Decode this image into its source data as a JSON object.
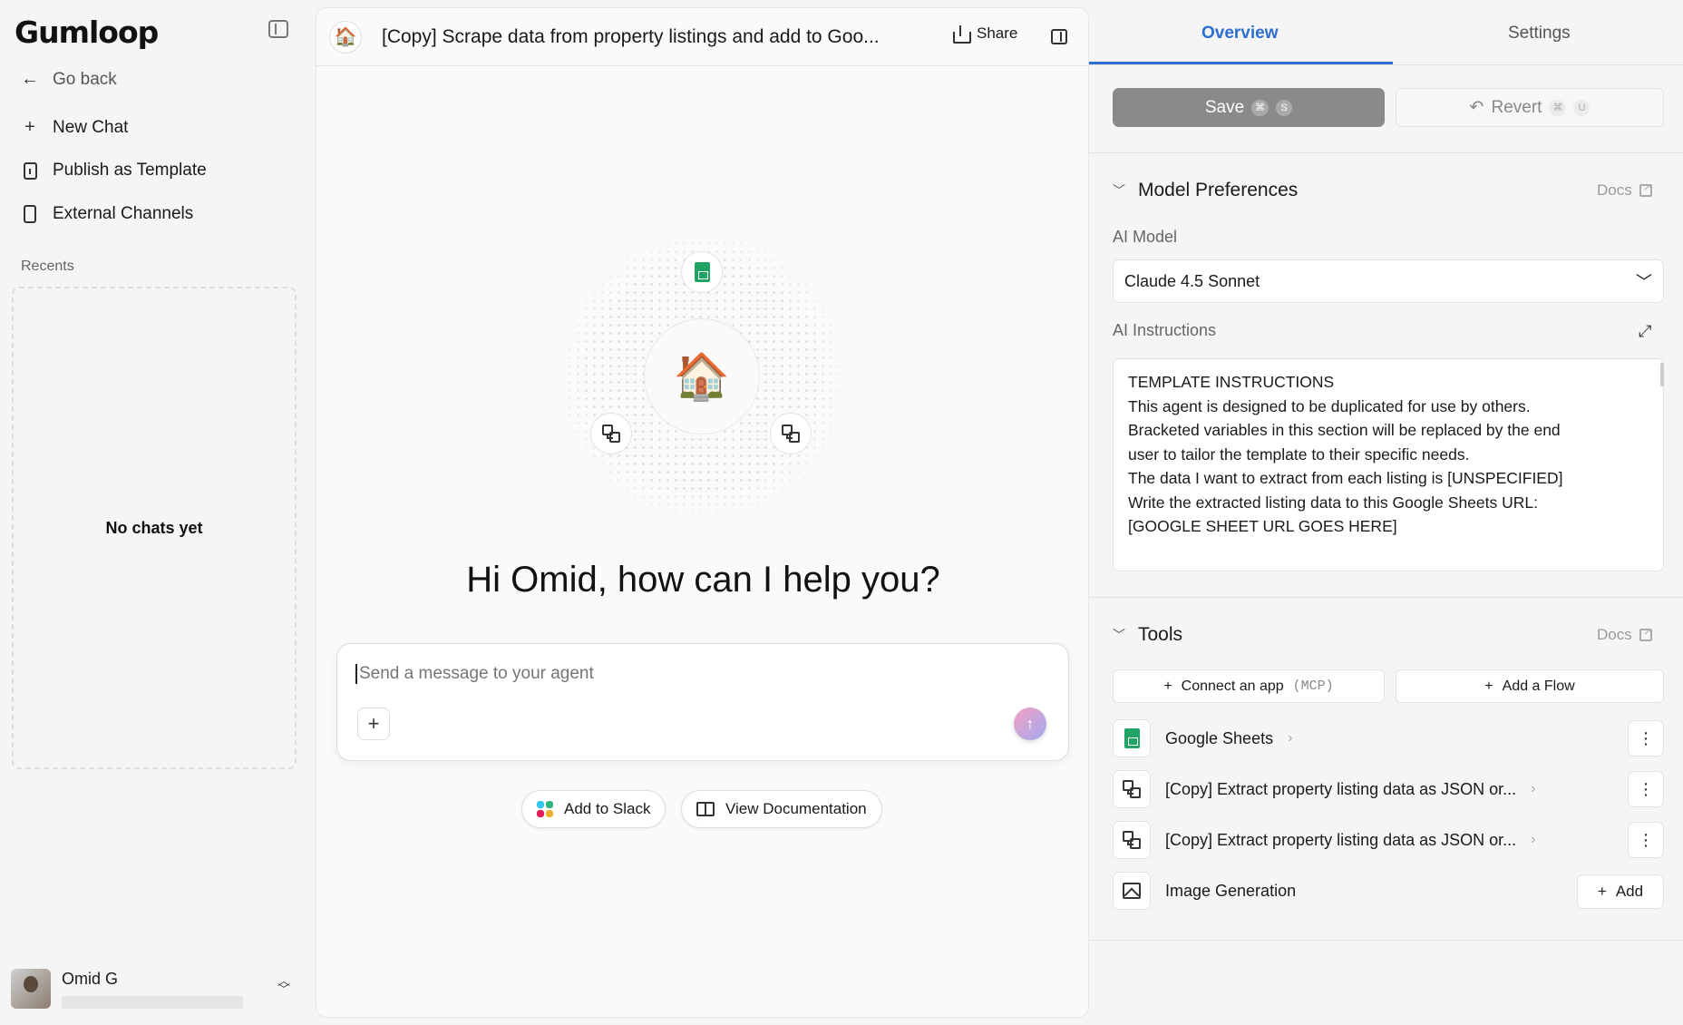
{
  "sidebar": {
    "logo": "Gumloop",
    "go_back": "Go back",
    "new_chat": "New Chat",
    "publish": "Publish as Template",
    "external": "External Channels",
    "recents_label": "Recents",
    "empty": "No chats yet",
    "user_name": "Omid G"
  },
  "header": {
    "title": "[Copy] Scrape data from property listings and add to Goo...",
    "agent_emoji": "🏠",
    "share": "Share"
  },
  "main": {
    "center_emoji": "🏠",
    "greeting": "Hi Omid, how can I help you?",
    "composer_placeholder": "Send a message to your agent",
    "add_to_slack": "Add to Slack",
    "view_docs": "View Documentation"
  },
  "right_panel": {
    "tabs": [
      "Overview",
      "Settings"
    ],
    "save": "Save",
    "save_keys": [
      "⌘",
      "S"
    ],
    "revert": "Revert",
    "revert_keys": [
      "⌘",
      "U"
    ],
    "model_prefs": {
      "title": "Model Preferences",
      "docs": "Docs",
      "ai_model_label": "AI Model",
      "ai_model_value": "Claude 4.5 Sonnet",
      "ai_instructions_label": "AI Instructions",
      "instructions": [
        "TEMPLATE INSTRUCTIONS",
        "This agent is designed to be duplicated for use by others.",
        "Bracketed variables in this section will be replaced by the end",
        "user to tailor the template to their specific needs.",
        "The data I want to extract from each listing is [UNSPECIFIED]",
        "Write the extracted listing data to this Google Sheets URL:",
        "[GOOGLE SHEET URL GOES HERE]"
      ]
    },
    "tools": {
      "title": "Tools",
      "docs": "Docs",
      "connect_app": "Connect an app",
      "mcp": "(MCP)",
      "add_flow": "Add a Flow",
      "items": [
        {
          "name": "Google Sheets",
          "icon": "google-sheets-icon"
        },
        {
          "name": "[Copy] Extract property listing data as JSON or...",
          "icon": "flow-icon"
        },
        {
          "name": "[Copy] Extract property listing data as JSON or...",
          "icon": "flow-icon"
        },
        {
          "name": "Image Generation",
          "icon": "image-icon"
        }
      ],
      "add": "Add"
    }
  },
  "colors": {
    "accent": "#2c6fd1",
    "save_bg": "#8a8a8a",
    "sheets_green": "#1fa463"
  }
}
